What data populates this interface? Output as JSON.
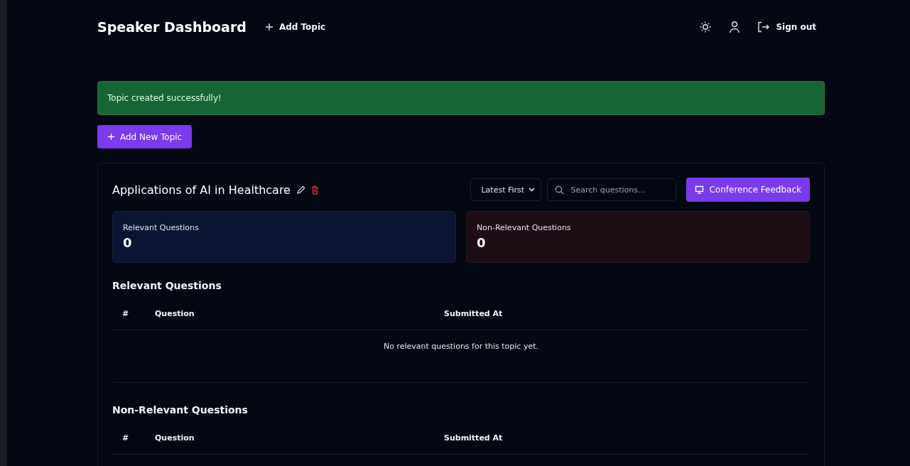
{
  "header": {
    "title": "Speaker Dashboard",
    "add_topic_link": "Add Topic",
    "sign_out": "Sign out"
  },
  "alert": {
    "message": "Topic created successfully!"
  },
  "add_new_topic_button": "Add New Topic",
  "topic": {
    "title": "Applications of AI in Healthcare",
    "sort": {
      "value": "Latest First"
    },
    "search": {
      "placeholder": "Search questions..."
    },
    "feedback_button": "Conference Feedback",
    "stats": [
      {
        "kind": "relevant",
        "label": "Relevant Questions",
        "count": "0"
      },
      {
        "kind": "non_relevant",
        "label": "Non-Relevant Questions",
        "count": "0"
      }
    ],
    "sections": [
      {
        "heading": "Relevant Questions",
        "columns": [
          "#",
          "Question",
          "Submitted At"
        ],
        "empty_message": "No relevant questions for this topic yet."
      },
      {
        "heading": "Non-Relevant Questions",
        "columns": [
          "#",
          "Question",
          "Submitted At"
        ]
      }
    ]
  }
}
